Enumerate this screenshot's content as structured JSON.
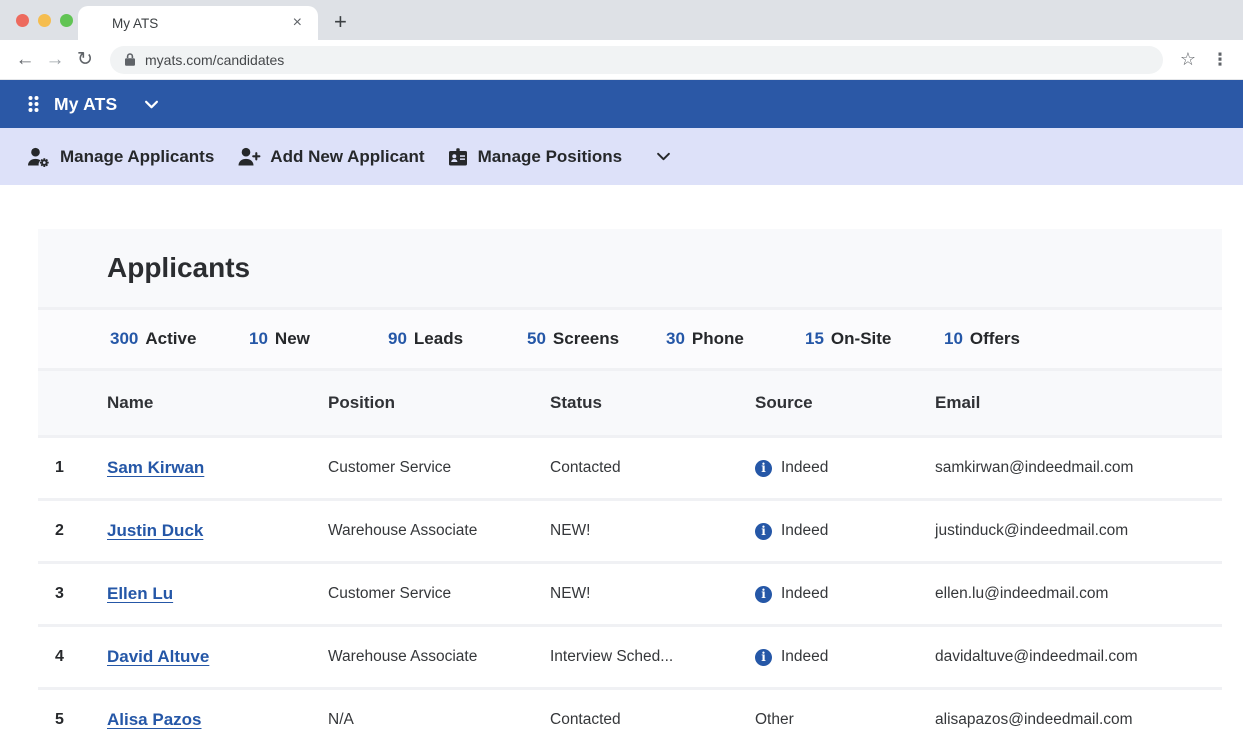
{
  "browser": {
    "tab_title": "My ATS",
    "url": "myats.com/candidates"
  },
  "icons": {
    "back": "←",
    "forward": "→",
    "reload": "↻",
    "star": "☆",
    "kebab": "⋮",
    "close": "×",
    "new_tab": "+",
    "indeed_glyph": "i"
  },
  "app_header": {
    "title": "My ATS"
  },
  "toolbar": {
    "items": [
      {
        "label": "Manage Applicants",
        "icon": "person-gear"
      },
      {
        "label": "Add New Applicant",
        "icon": "person-plus"
      },
      {
        "label": "Manage Positions",
        "icon": "contact-card"
      }
    ]
  },
  "page": {
    "title": "Applicants"
  },
  "stats": [
    {
      "value": "300",
      "label": "Active"
    },
    {
      "value": "10",
      "label": "New"
    },
    {
      "value": "90",
      "label": "Leads"
    },
    {
      "value": "50",
      "label": "Screens"
    },
    {
      "value": "30",
      "label": "Phone"
    },
    {
      "value": "15",
      "label": "On-Site"
    },
    {
      "value": "10",
      "label": "Offers"
    }
  ],
  "table": {
    "columns": [
      "Name",
      "Position",
      "Status",
      "Source",
      "Email"
    ],
    "rows": [
      {
        "num": "1",
        "name": "Sam Kirwan",
        "position": "Customer Service",
        "status": "Contacted",
        "source": "Indeed",
        "source_icon": true,
        "email": "samkirwan@indeedmail.com"
      },
      {
        "num": "2",
        "name": "Justin Duck",
        "position": "Warehouse Associate",
        "status": "NEW!",
        "source": "Indeed",
        "source_icon": true,
        "email": "justinduck@indeedmail.com"
      },
      {
        "num": "3",
        "name": "Ellen Lu",
        "position": "Customer Service",
        "status": "NEW!",
        "source": "Indeed",
        "source_icon": true,
        "email": "ellen.lu@indeedmail.com"
      },
      {
        "num": "4",
        "name": "David Altuve",
        "position": "Warehouse Associate",
        "status": "Interview Sched...",
        "source": "Indeed",
        "source_icon": true,
        "email": "davidaltuve@indeedmail.com"
      },
      {
        "num": "5",
        "name": "Alisa Pazos",
        "position": "N/A",
        "status": "Contacted",
        "source": "Other",
        "source_icon": false,
        "email": "alisapazos@indeedmail.com"
      }
    ]
  },
  "colors": {
    "accent_blue": "#2557A7",
    "header_bg": "#2B58A6",
    "toolbar_bg": "#DDE1F9"
  }
}
